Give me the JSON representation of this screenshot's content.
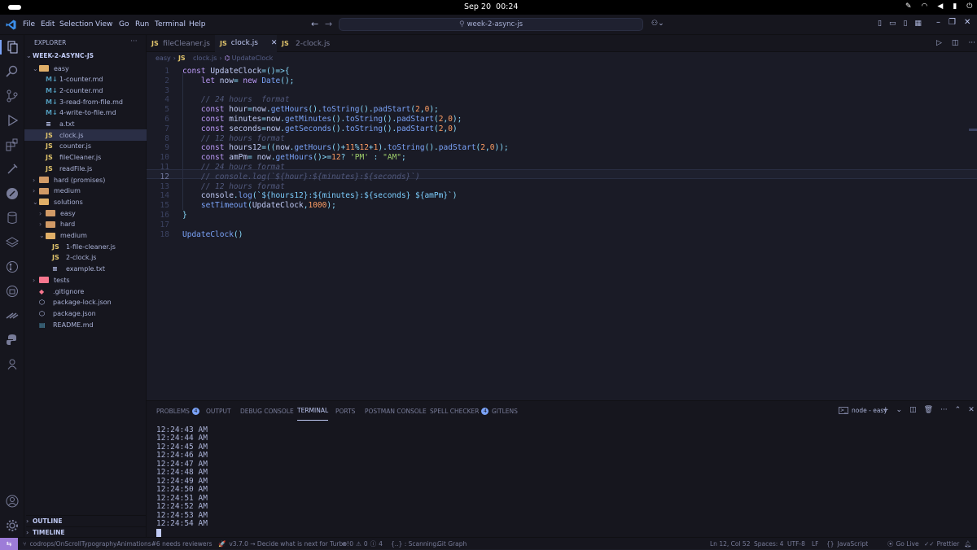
{
  "system": {
    "datetime": "Sep 20  00:24"
  },
  "menu": [
    "File",
    "Edit",
    "Selection",
    "View",
    "Go",
    "Run",
    "Terminal",
    "Help"
  ],
  "search": {
    "value": "week-2-async-js"
  },
  "explorer": {
    "title": "EXPLORER",
    "root": "WEEK-2-ASYNC-JS",
    "items": [
      {
        "label": "easy",
        "kind": "folder-open",
        "depth": 1
      },
      {
        "label": "1-counter.md",
        "kind": "md",
        "depth": 2
      },
      {
        "label": "2-counter.md",
        "kind": "md",
        "depth": 2
      },
      {
        "label": "3-read-from-file.md",
        "kind": "md",
        "depth": 2
      },
      {
        "label": "4-write-to-file.md",
        "kind": "md",
        "depth": 2
      },
      {
        "label": "a.txt",
        "kind": "txt",
        "depth": 2
      },
      {
        "label": "clock.js",
        "kind": "js",
        "depth": 2,
        "selected": true
      },
      {
        "label": "counter.js",
        "kind": "js",
        "depth": 2
      },
      {
        "label": "fileCleaner.js",
        "kind": "js",
        "depth": 2
      },
      {
        "label": "readFile.js",
        "kind": "js",
        "depth": 2
      },
      {
        "label": "hard (promises)",
        "kind": "folder",
        "depth": 1
      },
      {
        "label": "medium",
        "kind": "folder",
        "depth": 1
      },
      {
        "label": "solutions",
        "kind": "folder-open",
        "depth": 1
      },
      {
        "label": "easy",
        "kind": "folder",
        "depth": 2
      },
      {
        "label": "hard",
        "kind": "folder",
        "depth": 2
      },
      {
        "label": "medium",
        "kind": "folder-open",
        "depth": 2
      },
      {
        "label": "1-file-cleaner.js",
        "kind": "js",
        "depth": 3
      },
      {
        "label": "2-clock.js",
        "kind": "js",
        "depth": 3
      },
      {
        "label": "example.txt",
        "kind": "txt",
        "depth": 3
      },
      {
        "label": "tests",
        "kind": "folder-red",
        "depth": 1
      },
      {
        "label": ".gitignore",
        "kind": "git",
        "depth": 1
      },
      {
        "label": "package-lock.json",
        "kind": "json",
        "depth": 1
      },
      {
        "label": "package.json",
        "kind": "json",
        "depth": 1
      },
      {
        "label": "README.md",
        "kind": "readme",
        "depth": 1
      }
    ],
    "outline": "OUTLINE",
    "timeline": "TIMELINE"
  },
  "tabs": [
    {
      "label": "fileCleaner.js",
      "active": false
    },
    {
      "label": "clock.js",
      "active": true
    },
    {
      "label": "2-clock.js",
      "active": false
    }
  ],
  "breadcrumb": {
    "folder": "easy",
    "file": "clock.js",
    "symbol": "UpdateClock"
  },
  "code_lines": [
    "const UpdateClock=()=>{",
    "    let now= new Date();",
    "",
    "    // 24 hours  format",
    "    const hour=now.getHours().toString().padStart(2,0);",
    "    const minutes=now.getMinutes().toString().padStart(2,0);",
    "    const seconds=now.getSeconds().toString().padStart(2,0)",
    "    // 12 hours format",
    "    const hours12=((now.getHours()+11%12+1).toString().padStart(2,0));",
    "    const amPm= now.getHours()>=12? 'PM' : \"AM\";",
    "    // 24 hours format",
    "    // console.log(`${hour}:${minutes}:${seconds}`)",
    "    // 12 hours format",
    "    console.log(`${hours12}:${minutes}:${seconds} ${amPm}`)",
    "    setTimeout(UpdateClock,1000);",
    "}",
    "",
    "UpdateClock()"
  ],
  "panel": {
    "tabs": [
      {
        "label": "PROBLEMS",
        "badge": "4"
      },
      {
        "label": "OUTPUT"
      },
      {
        "label": "DEBUG CONSOLE"
      },
      {
        "label": "TERMINAL",
        "active": true
      },
      {
        "label": "PORTS"
      },
      {
        "label": "POSTMAN CONSOLE"
      },
      {
        "label": "SPELL CHECKER",
        "badge": "4"
      },
      {
        "label": "GITLENS"
      }
    ],
    "terminal_name": "node - easy",
    "terminal_lines": [
      "12:24:43 AM",
      "12:24:44 AM",
      "12:24:45 AM",
      "12:24:46 AM",
      "12:24:47 AM",
      "12:24:48 AM",
      "12:24:49 AM",
      "12:24:50 AM",
      "12:24:51 AM",
      "12:24:52 AM",
      "12:24:53 AM",
      "12:24:54 AM"
    ]
  },
  "status": {
    "branch_info": "codrops/OnScrollTypographyAnimations#6 needs reviewers",
    "turbo": "v3.7.0 → Decide what is next for Turbo!",
    "errors": "0",
    "warnings": "0",
    "info": "4",
    "scanning": "{..} : Scanning..",
    "git_graph": "Git Graph",
    "position": "Ln 12, Col 52",
    "spaces": "Spaces: 4",
    "encoding": "UTF-8",
    "eol": "LF",
    "language": "JavaScript",
    "golive": "Go Live",
    "prettier": "Prettier"
  },
  "colors": {
    "accent": "#7aa2f7",
    "background": "#1a1b26",
    "sidebar": "#16161e",
    "remote": "#9d7cd8"
  }
}
